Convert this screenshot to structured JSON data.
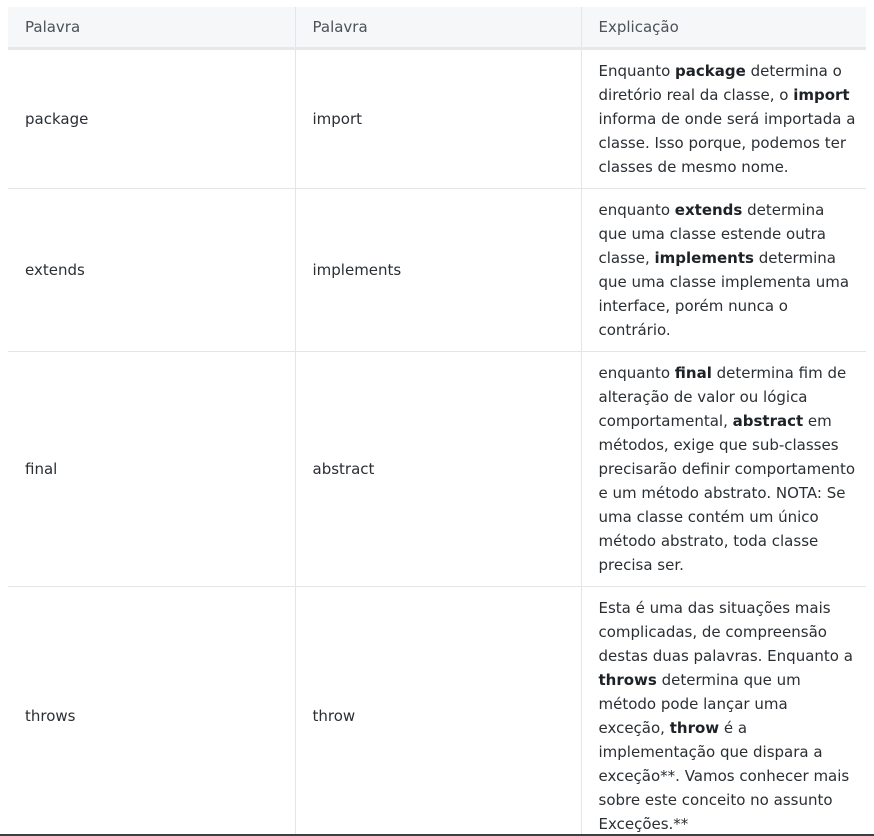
{
  "table": {
    "headers": [
      "Palavra",
      "Palavra",
      "Explicação"
    ],
    "rows": [
      {
        "word1": "package",
        "word2": "import",
        "explanation": [
          {
            "t": "Enquanto "
          },
          {
            "t": "package",
            "b": true
          },
          {
            "t": " determina o diretório real da classe, o "
          },
          {
            "t": "import",
            "b": true
          },
          {
            "t": " informa de onde será importada a classe. Isso porque, podemos ter classes de mesmo nome."
          }
        ]
      },
      {
        "word1": "extends",
        "word2": "implements",
        "explanation": [
          {
            "t": "enquanto "
          },
          {
            "t": "extends",
            "b": true
          },
          {
            "t": " determina que uma classe estende outra classe, "
          },
          {
            "t": "implements",
            "b": true
          },
          {
            "t": " determina que uma classe implementa uma interface, porém nunca o contrário."
          }
        ]
      },
      {
        "word1": "final",
        "word2": "abstract",
        "explanation": [
          {
            "t": "enquanto "
          },
          {
            "t": "final",
            "b": true
          },
          {
            "t": " determina fim de alteração de valor ou lógica comportamental, "
          },
          {
            "t": "abstract",
            "b": true
          },
          {
            "t": " em métodos, exige que sub-classes precisarão definir comportamento e um método abstrato. NOTA: Se uma classe contém um único método abstrato, toda classe precisa ser."
          }
        ]
      },
      {
        "word1": "throws",
        "word2": "throw",
        "explanation": [
          {
            "t": "Esta é uma das situações mais complicadas, de compreensão destas duas palavras. Enquanto a "
          },
          {
            "t": "throws",
            "b": true
          },
          {
            "t": " determina que um método pode lançar uma exceção, "
          },
          {
            "t": "throw",
            "b": true
          },
          {
            "t": " é a implementação que dispara a exceção**. Vamos conhecer mais sobre este conceito no assunto Exceções.**"
          }
        ]
      }
    ]
  }
}
